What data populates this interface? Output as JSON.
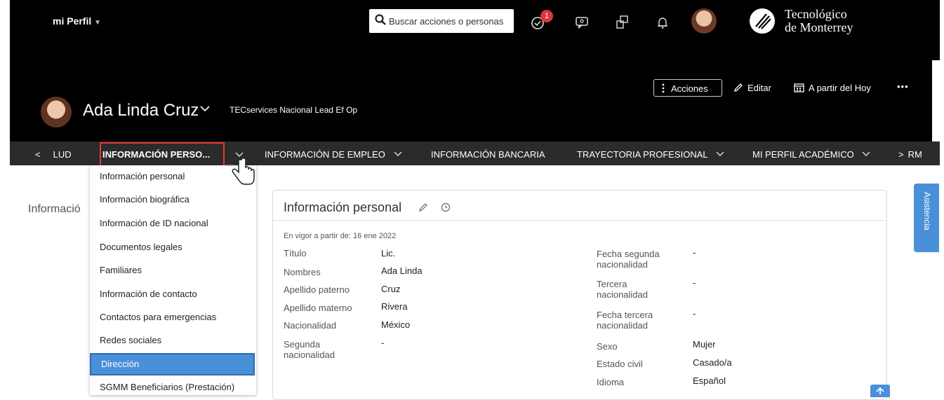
{
  "header": {
    "menu_label": "mi Perfil",
    "search_placeholder": "Buscar acciones o personas",
    "notification_count": "1",
    "logo_line1": "Tecnológico",
    "logo_line2": "de Monterrey"
  },
  "profile": {
    "name": "Ada Linda Cruz",
    "role": "TECservices Nacional Lead Ef Op",
    "actions": {
      "acciones": "Acciones",
      "editar": "Editar",
      "hoy": "A partir del Hoy",
      "more": "•••"
    }
  },
  "tabs": {
    "prev_label": "LUD",
    "items": [
      {
        "label": "INFORMACIÓN PERSO..."
      },
      {
        "label": "INFORMACIÓN DE EMPLEO"
      },
      {
        "label": "INFORMACIÓN BANCARIA"
      },
      {
        "label": "TRAYECTORIA PROFESIONAL"
      },
      {
        "label": "MI PERFIL ACADÉMICO"
      }
    ],
    "next_label": "RM"
  },
  "dropdown": {
    "items": [
      {
        "label": "Información personal"
      },
      {
        "label": "Información biográfica"
      },
      {
        "label": "Información de ID nacional"
      },
      {
        "label": "Documentos legales"
      },
      {
        "label": "Familiares"
      },
      {
        "label": "Información de contacto"
      },
      {
        "label": "Contactos para emergencias"
      },
      {
        "label": "Redes sociales"
      },
      {
        "label": "Dirección"
      },
      {
        "label": "SGMM Beneficiarios (Prestación)"
      }
    ]
  },
  "page": {
    "side_heading": "Informació"
  },
  "card": {
    "title": "Información personal",
    "effective": "En vigor a partir de: 16 ene 2022",
    "left_fields": [
      {
        "label": "Título",
        "value": "Lic."
      },
      {
        "label": "Nombres",
        "value": "Ada Linda"
      },
      {
        "label": "Apellido paterno",
        "value": "Cruz"
      },
      {
        "label": "Apellido materno",
        "value": "Rivera"
      },
      {
        "label": "Nacionalidad",
        "value": "México"
      },
      {
        "label": "Segunda nacionalidad",
        "value": "-"
      }
    ],
    "right_fields": [
      {
        "label": "Fecha segunda nacionalidad",
        "value": "-"
      },
      {
        "label": "Tercera nacionalidad",
        "value": "-"
      },
      {
        "label": "Fecha tercera nacionalidad",
        "value": "-"
      },
      {
        "label": "Sexo",
        "value": "Mujer"
      },
      {
        "label": "Estado civil",
        "value": "Casado/a"
      },
      {
        "label": "Idioma",
        "value": "Español"
      }
    ]
  },
  "assist": {
    "label": "Asistencia"
  },
  "colors": {
    "accent": "#4a90d9",
    "highlight_box": "#e53935",
    "header_bg": "#000000",
    "tabs_bg": "#2b2b2b"
  }
}
